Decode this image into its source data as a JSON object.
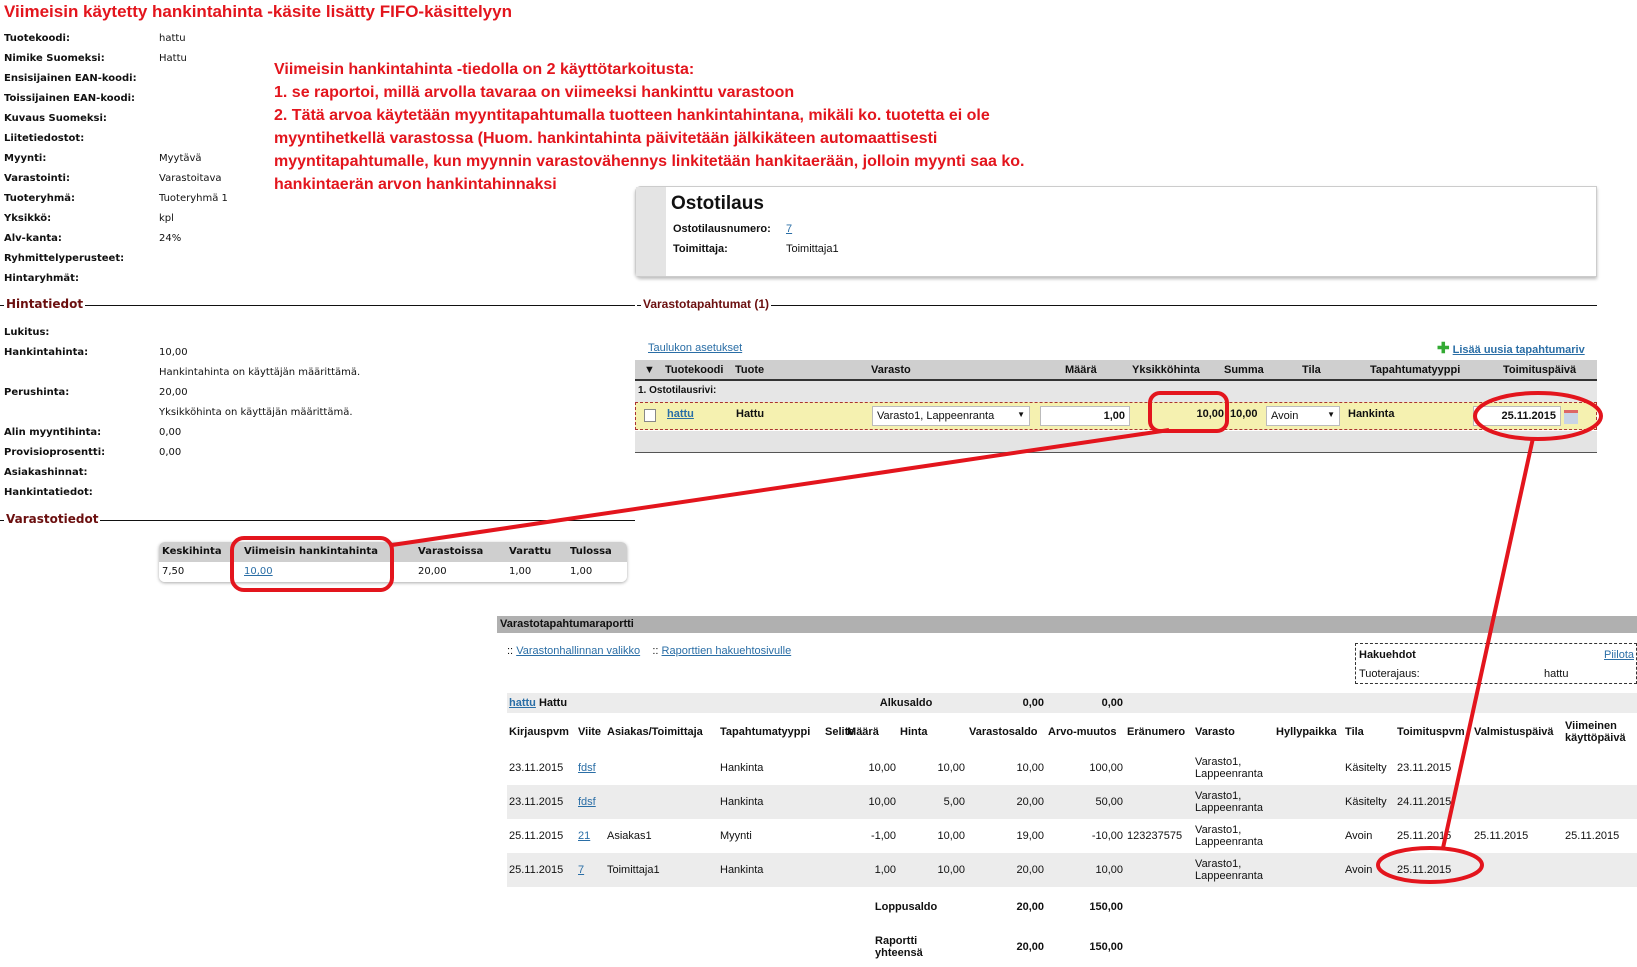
{
  "title": "Viimeisin käytetty hankintahinta -käsite lisätty FIFO-käsittelyyn",
  "note": [
    "Viimeisin hankintahinta -tiedolla on 2 käyttötarkoitusta:",
    "1. se raportoi, millä arvolla tavaraa on viimeeksi hankinttu varastoon",
    "2. Tätä arvoa käytetään myyntitapahtumalla tuotteen hankintahintana, mikäli ko. tuotetta ei ole",
    "myyntihetkellä varastossa (Huom. hankintahinta päivitetään jälkikäteen automaattisesti",
    "myyntitapahtumalle, kun myynnin varastovähennys linkitetään hankitaerään, jolloin myynti saa ko.",
    "hankintaerän arvon hankintahinnaksi"
  ],
  "product": [
    {
      "label": "Tuotekoodi:",
      "value": "hattu"
    },
    {
      "label": "Nimike Suomeksi:",
      "value": "Hattu"
    },
    {
      "label": "Ensisijainen EAN-koodi:",
      "value": ""
    },
    {
      "label": "Toissijainen EAN-koodi:",
      "value": ""
    },
    {
      "label": "Kuvaus Suomeksi:",
      "value": ""
    },
    {
      "label": "Liitetiedostot:",
      "value": ""
    },
    {
      "label": "Myynti:",
      "value": "Myytävä"
    },
    {
      "label": "Varastointi:",
      "value": "Varastoitava"
    },
    {
      "label": "Tuoteryhmä:",
      "value": "Tuoteryhmä 1"
    },
    {
      "label": "Yksikkö:",
      "value": "kpl"
    },
    {
      "label": "Alv-kanta:",
      "value": "24%"
    },
    {
      "label": "Ryhmittelyperusteet:",
      "value": ""
    },
    {
      "label": "Hintaryhmät:",
      "value": ""
    }
  ],
  "pricing": {
    "section": "Hintatiedot",
    "rows": [
      {
        "label": "Lukitus:",
        "value": ""
      },
      {
        "label": "Hankintahinta:",
        "value": "10,00"
      },
      {
        "label": "",
        "value": "Hankintahinta on käyttäjän määrittämä."
      },
      {
        "label": "Perushinta:",
        "value": "20,00"
      },
      {
        "label": "",
        "value": "Yksikköhinta on käyttäjän määrittämä."
      },
      {
        "label": "Alin myyntihinta:",
        "value": "0,00"
      },
      {
        "label": "Provisioprosentti:",
        "value": "0,00"
      },
      {
        "label": "Asiakashinnat:",
        "value": ""
      },
      {
        "label": "Hankintatiedot:",
        "value": ""
      }
    ]
  },
  "stock": {
    "section": "Varastotiedot",
    "headers": [
      "Keskihinta",
      "Viimeisin hankintahinta",
      "Varastoissa",
      "Varattu",
      "Tulossa"
    ],
    "values": [
      "7,50",
      "10,00",
      "20,00",
      "1,00",
      "1,00"
    ]
  },
  "order": {
    "title": "Ostotilaus",
    "number_label": "Ostotilausnumero:",
    "number": "7",
    "supplier_label": "Toimittaja:",
    "supplier": "Toimittaja1"
  },
  "events": {
    "section": "Varastotapahtumat (1)",
    "settings_link": "Taulukon asetukset",
    "add_link": "Lisää uusia tapahtumariv",
    "headers": [
      "Tuotekoodi",
      "Tuote",
      "Varasto",
      "Määrä",
      "Yksikköhinta",
      "Summa",
      "Tila",
      "Tapahtumatyyppi",
      "Toimituspäivä"
    ],
    "group": "1. Ostotilausrivi:",
    "row": {
      "code": "hattu",
      "product": "Hattu",
      "warehouse": "Varasto1, Lappeenranta",
      "qty": "1,00",
      "unit_price": "10,00",
      "sum": "10,00",
      "status": "Avoin",
      "type": "Hankinta",
      "date": "25.11.2015"
    }
  },
  "report": {
    "title": "Varastotapahtumaraportti",
    "links": [
      "Varastonhallinnan valikko",
      "Raporttien hakuehtosivulle"
    ],
    "link_prefix": "::",
    "filters": {
      "title": "Hakuehdot",
      "hide": "Piilota",
      "label": "Tuoterajaus:",
      "value": "hattu"
    },
    "product_code": "hattu",
    "product_name": "Hattu",
    "opening_label": "Alkusaldo",
    "opening_qty": "0,00",
    "opening_value": "0,00",
    "headers": [
      "Kirjauspvm",
      "Viite",
      "Asiakas/Toimittaja",
      "Tapahtumatyyppi",
      "Selite",
      "Määrä",
      "Hinta",
      "Varastosaldo",
      "Arvo-muutos",
      "Eränumero",
      "Varasto",
      "Hyllypaikka",
      "Tila",
      "Toimituspvm",
      "Valmistuspäivä",
      "Viimeinen käyttöpäivä"
    ],
    "rows": [
      [
        "23.11.2015",
        "fdsf",
        "",
        "Hankinta",
        "",
        "10,00",
        "10,00",
        "10,00",
        "100,00",
        "",
        "Varasto1, Lappeenranta",
        "",
        "Käsitelty",
        "23.11.2015",
        "",
        ""
      ],
      [
        "23.11.2015",
        "fdsf",
        "",
        "Hankinta",
        "",
        "10,00",
        "5,00",
        "20,00",
        "50,00",
        "",
        "Varasto1, Lappeenranta",
        "",
        "Käsitelty",
        "24.11.2015",
        "",
        ""
      ],
      [
        "25.11.2015",
        "21",
        "Asiakas1",
        "Myynti",
        "",
        "-1,00",
        "10,00",
        "19,00",
        "-10,00",
        "123237575",
        "Varasto1, Lappeenranta",
        "",
        "Avoin",
        "25.11.2015",
        "25.11.2015",
        "25.11.2015"
      ],
      [
        "25.11.2015",
        "7",
        "Toimittaja1",
        "Hankinta",
        "",
        "1,00",
        "10,00",
        "20,00",
        "10,00",
        "",
        "Varasto1, Lappeenranta",
        "",
        "Avoin",
        "25.11.2015",
        "",
        ""
      ]
    ],
    "closing_label": "Loppusaldo",
    "closing_qty": "20,00",
    "closing_value": "150,00",
    "total_label": "Raportti yhteensä",
    "total_qty": "20,00",
    "total_value": "150,00"
  },
  "colors": {
    "annotation": "#e3151d",
    "section": "#6b0f0f",
    "link": "#2a6ea6",
    "highlight_row": "#f5f1b0"
  }
}
